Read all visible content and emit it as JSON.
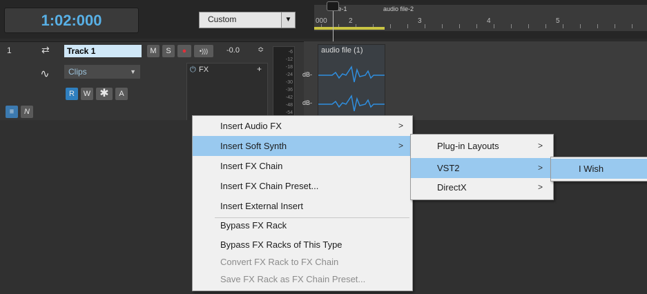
{
  "transport": {
    "time": "1:02:000"
  },
  "toolbar": {
    "preset_label": "Custom",
    "dropdown_arrow": "▼"
  },
  "timeline": {
    "clip_labels": [
      "file-1",
      "audio file-2"
    ],
    "ruler": [
      "000",
      "2",
      "3",
      "4",
      "5"
    ]
  },
  "track": {
    "number": "1",
    "name": "Track 1",
    "buttons": {
      "mute": "M",
      "solo": "S",
      "record": "●",
      "input_echo": "•)))"
    },
    "volume": "-0.0",
    "clips_selector": "Clips",
    "fx_label": "FX",
    "fx_add": "+",
    "write_buttons": [
      "R",
      "W",
      "✱",
      "A"
    ],
    "meter_scale": [
      "-6",
      "-12",
      "-18",
      "-24",
      "-30",
      "-36",
      "-42",
      "-48",
      "-54"
    ]
  },
  "lane": {
    "clip_title": "audio file (1)",
    "db_labels": [
      "dB-",
      "dB-"
    ]
  },
  "context_menu": {
    "items": [
      {
        "label": "Insert Audio FX",
        "submenu": true,
        "highlighted": false,
        "disabled": false
      },
      {
        "label": "Insert Soft Synth",
        "submenu": true,
        "highlighted": true,
        "disabled": false
      },
      {
        "label": "Insert FX Chain",
        "submenu": false,
        "highlighted": false,
        "disabled": false
      },
      {
        "label": "Insert FX Chain Preset...",
        "submenu": false,
        "highlighted": false,
        "disabled": false
      },
      {
        "label": "Insert External Insert",
        "submenu": false,
        "highlighted": false,
        "disabled": false
      },
      {
        "label": "Bypass FX Rack",
        "submenu": false,
        "highlighted": false,
        "disabled": false
      },
      {
        "label": "Bypass FX Racks of This Type",
        "submenu": false,
        "highlighted": false,
        "disabled": false
      },
      {
        "label": "Convert FX Rack to FX Chain",
        "submenu": false,
        "highlighted": false,
        "disabled": true
      },
      {
        "label": "Save FX Rack as FX Chain Preset...",
        "submenu": false,
        "highlighted": false,
        "disabled": true
      }
    ]
  },
  "submenu_soft_synth": {
    "items": [
      {
        "label": "Plug-in Layouts",
        "submenu": true,
        "highlighted": false
      },
      {
        "label": "VST2",
        "submenu": true,
        "highlighted": true
      },
      {
        "label": "DirectX",
        "submenu": true,
        "highlighted": false
      }
    ]
  },
  "submenu_vst2": {
    "items": [
      {
        "label": "I Wish",
        "highlighted": true
      }
    ]
  },
  "colors": {
    "time_display": "#58b0e6",
    "track_name_bg": "#cfe7f7",
    "menu_highlight": "#99c9ef",
    "waveform": "#2f8fe0",
    "loop_bar": "#c9c443",
    "record_button": "#e0303a"
  },
  "arrow_glyph": ">"
}
